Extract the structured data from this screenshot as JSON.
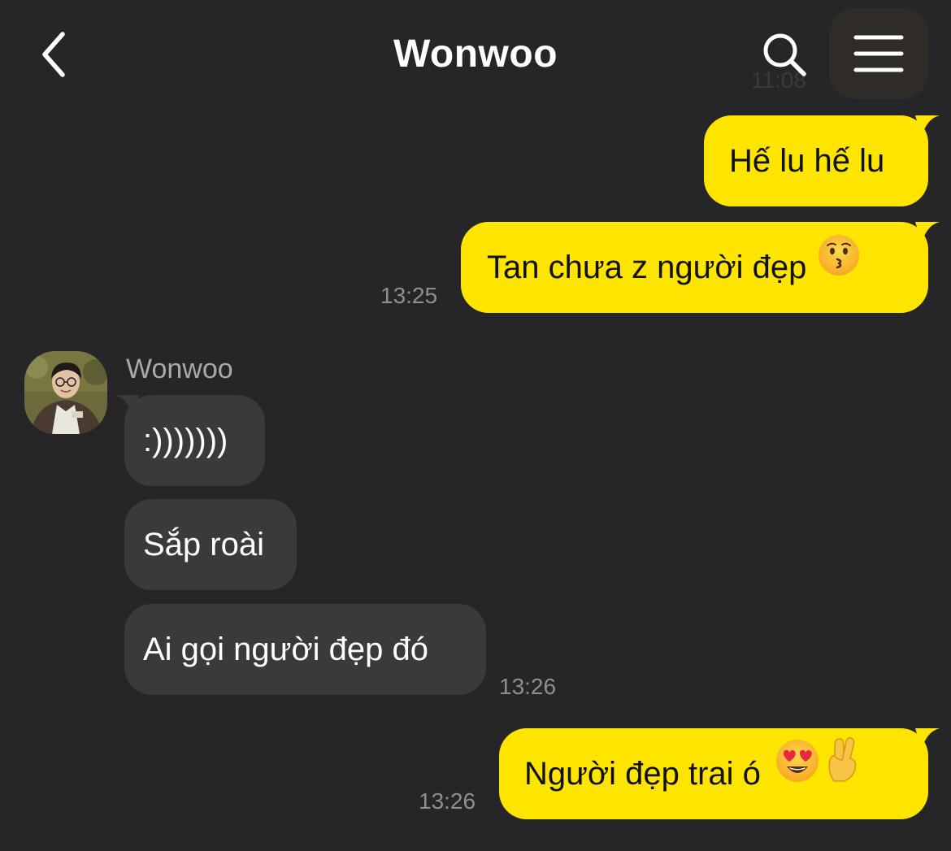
{
  "header": {
    "title": "Wonwoo",
    "back_icon": "chevron-left-icon",
    "search_icon": "search-icon",
    "menu_icon": "hamburger-menu-icon",
    "ghost_time": "11:08"
  },
  "colors": {
    "background": "#262628",
    "outgoing_bubble": "#fee500",
    "incoming_bubble": "#3a3a3c",
    "timestamp": "#8e8e93"
  },
  "messages": [
    {
      "direction": "out",
      "text": "Hế lu hế lu"
    },
    {
      "direction": "out",
      "text": "Tan chưa z người đẹp",
      "emoji": "kissing-face-icon",
      "time": "13:25"
    },
    {
      "direction": "in",
      "sender": "Wonwoo",
      "avatar": "avatar",
      "text": ":)))))))"
    },
    {
      "direction": "in",
      "text": "Sắp roài"
    },
    {
      "direction": "in",
      "text": "Ai gọi người đẹp đó",
      "time": "13:26"
    },
    {
      "direction": "out",
      "text": "Người đẹp trai ó",
      "emoji": "heart-eyes-face-icon",
      "emoji2": "crossed-fingers-icon",
      "time": "13:26"
    }
  ]
}
